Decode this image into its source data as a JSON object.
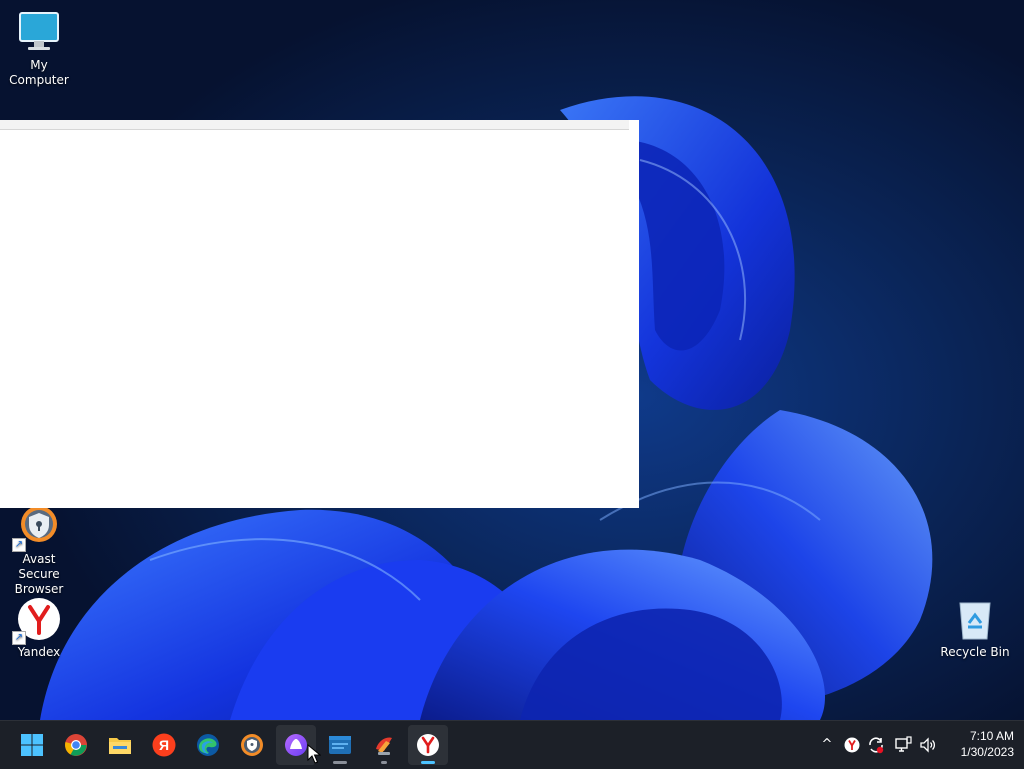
{
  "desktop": {
    "icons": [
      {
        "label": "My Computer"
      },
      {
        "label": "Avast Secure Browser"
      },
      {
        "label": "Yandex"
      },
      {
        "label": "Recycle Bin"
      }
    ]
  },
  "taskbar": {
    "apps": [
      {
        "name": "start-icon"
      },
      {
        "name": "chrome-icon"
      },
      {
        "name": "file-explorer-icon"
      },
      {
        "name": "yandex-ya-icon"
      },
      {
        "name": "edge-icon"
      },
      {
        "name": "avast-browser-icon"
      },
      {
        "name": "alice-assistant-icon"
      },
      {
        "name": "blue-window-app-icon"
      },
      {
        "name": "ccleaner-icon"
      },
      {
        "name": "yandex-browser-icon"
      }
    ],
    "tray": {
      "chevron": "^",
      "icons": [
        "yandex-tray-icon",
        "sync-tray-icon",
        "network-icon",
        "volume-icon"
      ]
    },
    "clock": {
      "time": "7:10 AM",
      "date": "1/30/2023"
    }
  },
  "colors": {
    "desktop_bg": "#071733",
    "bloom_blue": "#1f4fff",
    "taskbar_bg": "#1c2028",
    "window_bg": "#ffffff",
    "active_indicator": "#4cc2ff"
  }
}
